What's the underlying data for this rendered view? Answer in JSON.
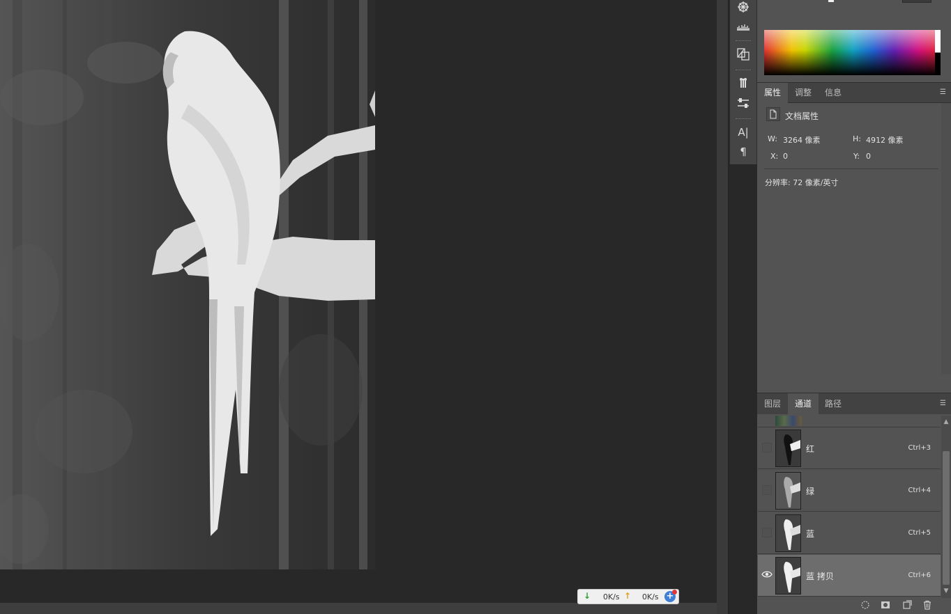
{
  "properties_panel": {
    "tabs": [
      "属性",
      "调整",
      "信息"
    ],
    "title": "文档属性",
    "width_label": "W:",
    "width_value": "3264 像素",
    "height_label": "H:",
    "height_value": "4912 像素",
    "x_label": "X:",
    "x_value": "0",
    "y_label": "Y:",
    "y_value": "0",
    "resolution": "分辨率: 72 像素/英寸"
  },
  "channels_panel": {
    "tabs": [
      "图层",
      "通道",
      "路径"
    ],
    "channels": [
      {
        "name": "红",
        "shortcut": "Ctrl+3",
        "visible": false,
        "selected": false
      },
      {
        "name": "绿",
        "shortcut": "Ctrl+4",
        "visible": false,
        "selected": false
      },
      {
        "name": "蓝",
        "shortcut": "Ctrl+5",
        "visible": false,
        "selected": false
      },
      {
        "name": "蓝 拷贝",
        "shortcut": "Ctrl+6",
        "visible": true,
        "selected": true
      }
    ]
  },
  "speed_widget": {
    "download": "0K/s",
    "upload": "0K/s"
  },
  "tool_icons": [
    "compass-icon",
    "histogram-icon",
    "clone-source-icon",
    "brush-presets-icon",
    "adjustment-sliders-icon",
    "character-icon",
    "paragraph-icon"
  ],
  "colors": {
    "workspace": "#282828",
    "panel": "#535353",
    "tabbar": "#424242",
    "selected_row": "#6d6d6d"
  }
}
